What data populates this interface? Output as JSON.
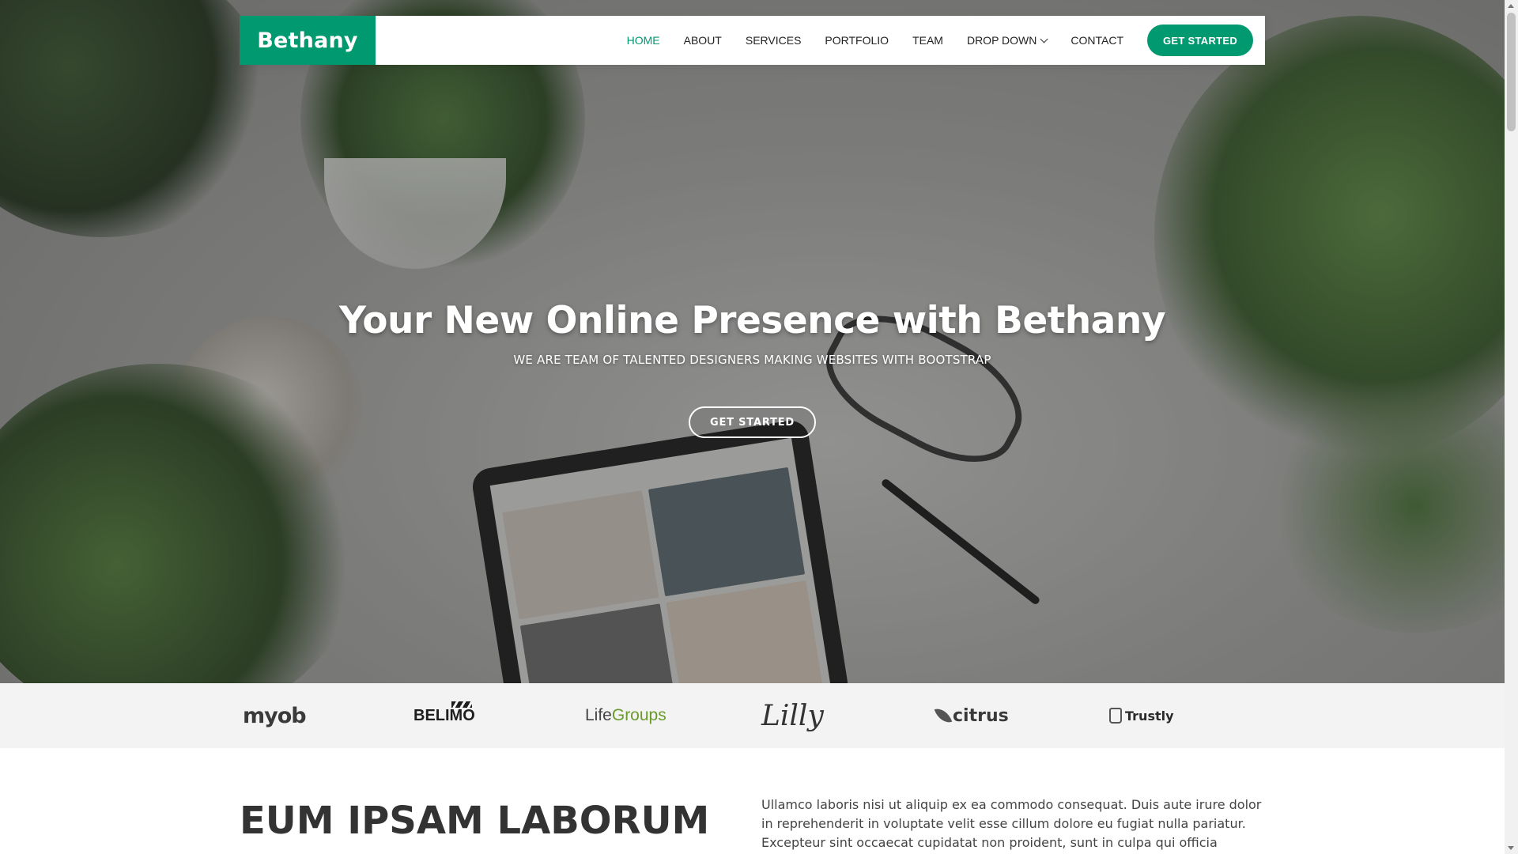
{
  "brand": {
    "logo": "Bethany",
    "accent_color": "#009970"
  },
  "nav": {
    "items": [
      {
        "label": "HOME",
        "active": true
      },
      {
        "label": "ABOUT"
      },
      {
        "label": "SERVICES"
      },
      {
        "label": "PORTFOLIO"
      },
      {
        "label": "TEAM"
      },
      {
        "label": "DROP DOWN",
        "has_dropdown": true,
        "icon": "chevron-down-icon"
      },
      {
        "label": "CONTACT"
      }
    ],
    "cta": "GET STARTED"
  },
  "hero": {
    "title": "Your New Online Presence with Bethany",
    "subtitle": "WE ARE TEAM OF TALENTED DESIGNERS MAKING WEBSITES WITH BOOTSTRAP",
    "button": "GET STARTED"
  },
  "clients": {
    "logos": [
      {
        "name": "myob"
      },
      {
        "name": "BELIMO"
      },
      {
        "name_part1": "Life",
        "name_part2": "Groups"
      },
      {
        "name": "Lilly"
      },
      {
        "name": "citrus"
      },
      {
        "name": "Trustly"
      }
    ]
  },
  "about": {
    "title": "EUM IPSAM LABORUM",
    "text": "Ullamco laboris nisi ut aliquip ex ea commodo consequat. Duis aute irure dolor in reprehenderit in voluptate velit esse cillum dolore eu fugiat nulla pariatur. Excepteur sint occaecat cupidatat non proident, sunt in culpa qui officia deserunt mollit anim id"
  }
}
